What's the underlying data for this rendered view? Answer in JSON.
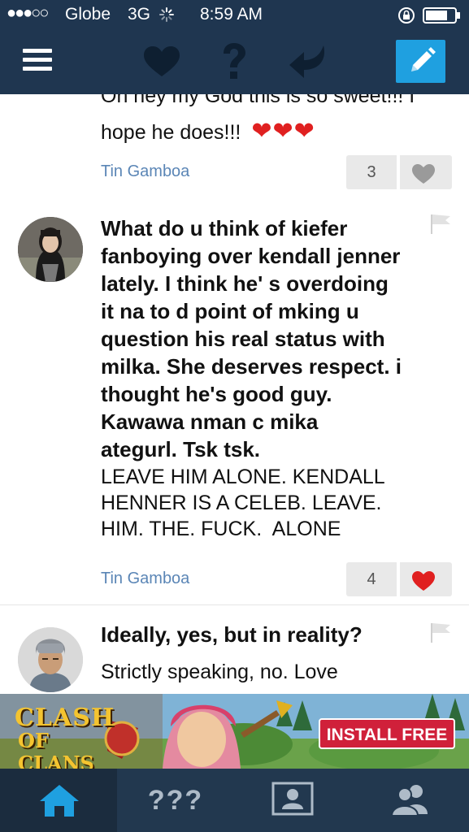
{
  "status_bar": {
    "signal": "●●●○○",
    "carrier": "Globe",
    "network": "3G",
    "time": "8:59 AM"
  },
  "nav": {
    "icons": [
      "menu-icon",
      "heart-icon",
      "question-icon",
      "reply-icon",
      "compose-icon"
    ]
  },
  "posts": [
    {
      "answer_lines": [
        "Oh hey my God this is so sweet!!! I",
        "hope he does!!!"
      ],
      "emoji": "❤❤❤",
      "author": "Tin Gamboa",
      "likes": "3",
      "liked": false
    },
    {
      "question_lines": [
        "What do u think of kiefer",
        "fanboying over kendall jenner",
        "lately. I think he' s overdoing",
        "it na to d point of mking u",
        "question his real status with",
        "milka. She deserves respect. i",
        "thought he's good guy.",
        "Kawawa nman c mika",
        "ategurl. Tsk tsk."
      ],
      "answer_lines": [
        "LEAVE HIM ALONE. KENDALL",
        "HENNER IS A CELEB. LEAVE.",
        "HIM. THE. FUCK.  ALONE"
      ],
      "author": "Tin Gamboa",
      "likes": "4",
      "liked": true
    },
    {
      "question_lines": [
        "Ideally, yes, but in reality?"
      ],
      "answer_lines": [
        "Strictly speaking, no. Love"
      ]
    }
  ],
  "ad": {
    "game_title_1": "CLASH",
    "game_title_2": "OF CLANS",
    "cta": "INSTALL FREE"
  },
  "tabs": {
    "questions_label": "???"
  },
  "colors": {
    "nav_bg": "#1f3650",
    "tab_bg": "#22384f",
    "link": "#5b86b6",
    "heart_red": "#e02020",
    "compose_bg": "#1fa0e0"
  }
}
